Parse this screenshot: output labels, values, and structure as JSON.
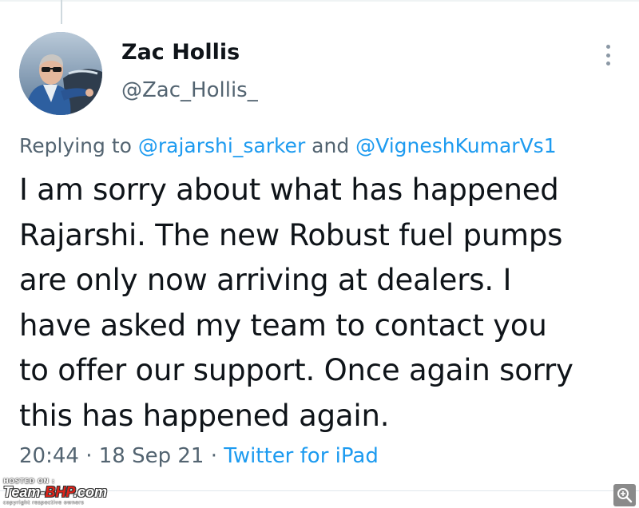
{
  "tweet": {
    "author_name": "Zac Hollis",
    "author_handle": "@Zac_Hollis_",
    "replying_prefix": "Replying to ",
    "reply_mention_1": "@rajarshi_sarker",
    "reply_connector": " and ",
    "reply_mention_2": "@VigneshKumarVs1",
    "text_lines": [
      "I am sorry about what has happened",
      "Rajarshi. The new Robust fuel pumps",
      "are only now arriving at dealers. I",
      "have asked my team to contact you",
      "to offer our support. Once again sorry",
      "this has happened again."
    ],
    "time": "20:44",
    "separator": " · ",
    "date": "18 Sep 21",
    "source": "Twitter for iPad"
  },
  "watermark": {
    "hosted_on": "HOSTED ON :",
    "brand_prefix": "Team-",
    "brand_highlight": "BHP",
    "brand_suffix": ".com",
    "copyright": "copyright respective owners"
  },
  "icons": {
    "more": "more-vertical-icon",
    "zoom": "zoom-icon"
  },
  "colors": {
    "link": "#1d9bf0",
    "secondary_text": "#536471",
    "primary_text": "#0f1419",
    "brand_red": "#e0241b"
  }
}
